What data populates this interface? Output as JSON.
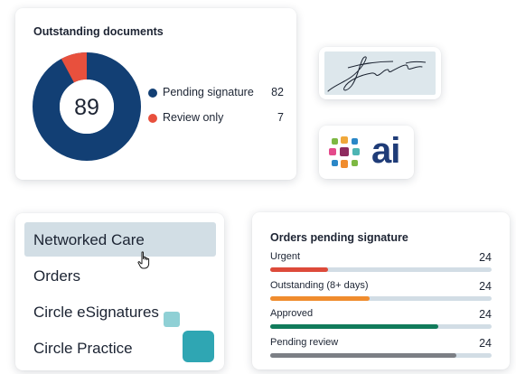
{
  "docs": {
    "title": "Outstanding documents",
    "total": "89",
    "legend": [
      {
        "label": "Pending signature",
        "value": "82",
        "color": "#123f74"
      },
      {
        "label": "Review only",
        "value": "7",
        "color": "#e8503d"
      }
    ]
  },
  "ai": {
    "text": "ai",
    "dot_colors": [
      "#7db843",
      "#e44a8b",
      "#2a87c7",
      "#8e2b5e",
      "#f0a83a",
      "#4db5b3"
    ]
  },
  "menu": {
    "items": [
      {
        "label": "Networked Care",
        "active": true
      },
      {
        "label": "Orders",
        "active": false
      },
      {
        "label": "Circle eSignatures",
        "active": false
      },
      {
        "label": "Circle Practice",
        "active": false
      }
    ]
  },
  "orders": {
    "title": "Orders pending signature",
    "rows": [
      {
        "label": "Urgent",
        "value": "24",
        "fill": 0.26,
        "color": "#dd4a3a"
      },
      {
        "label": "Outstanding (8+ days)",
        "value": "24",
        "fill": 0.45,
        "color": "#f08c2e"
      },
      {
        "label": "Approved",
        "value": "24",
        "fill": 0.76,
        "color": "#117b5b"
      },
      {
        "label": "Pending review",
        "value": "24",
        "fill": 0.84,
        "color": "#7c7f85"
      }
    ]
  }
}
